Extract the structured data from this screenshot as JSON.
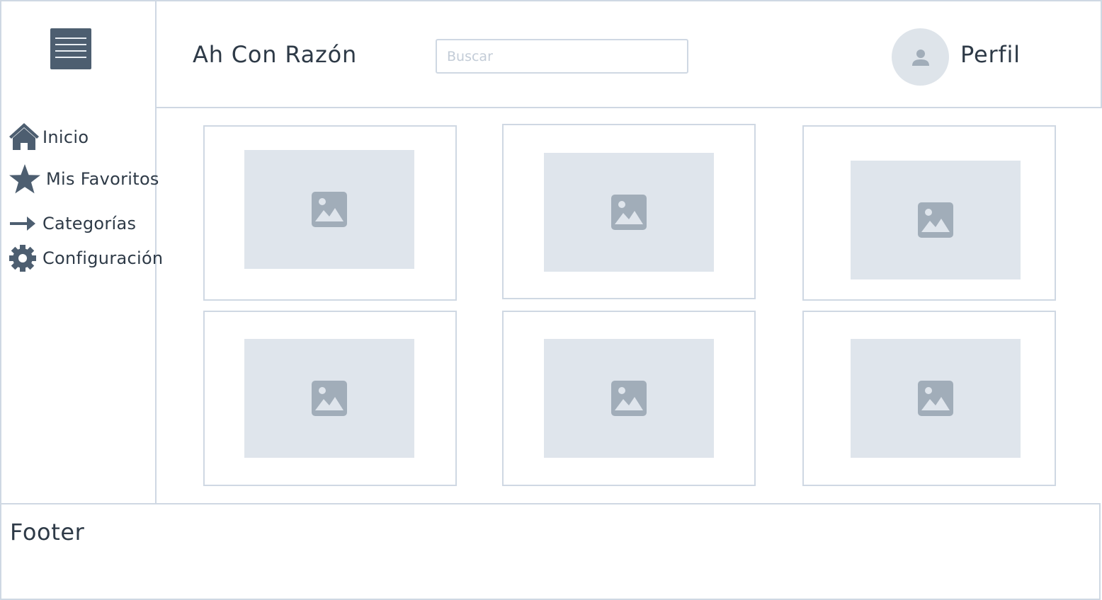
{
  "sidebar": {
    "menu_icon": "hamburger-menu-icon",
    "items": [
      {
        "label": "Inicio",
        "icon": "home-icon"
      },
      {
        "label": "Mis Favoritos",
        "icon": "star-icon"
      },
      {
        "label": "Categorías",
        "icon": "arrow-right-icon"
      },
      {
        "label": "Configuración",
        "icon": "gear-icon"
      }
    ]
  },
  "header": {
    "title": "Ah Con Razón",
    "search_placeholder": "Buscar",
    "search_value": "",
    "profile_label": "Perfil",
    "avatar_icon": "user-icon"
  },
  "grid": {
    "cards": [
      {
        "image_icon": "image-placeholder-icon"
      },
      {
        "image_icon": "image-placeholder-icon"
      },
      {
        "image_icon": "image-placeholder-icon"
      },
      {
        "image_icon": "image-placeholder-icon"
      },
      {
        "image_icon": "image-placeholder-icon"
      },
      {
        "image_icon": "image-placeholder-icon"
      }
    ]
  },
  "footer": {
    "label": "Footer"
  },
  "colors": {
    "border": "#cfd8e3",
    "icon_dark": "#4d5e70",
    "placeholder_fill": "#dfe5ec",
    "image_icon": "#a1adb9",
    "text": "#2e3a47"
  }
}
